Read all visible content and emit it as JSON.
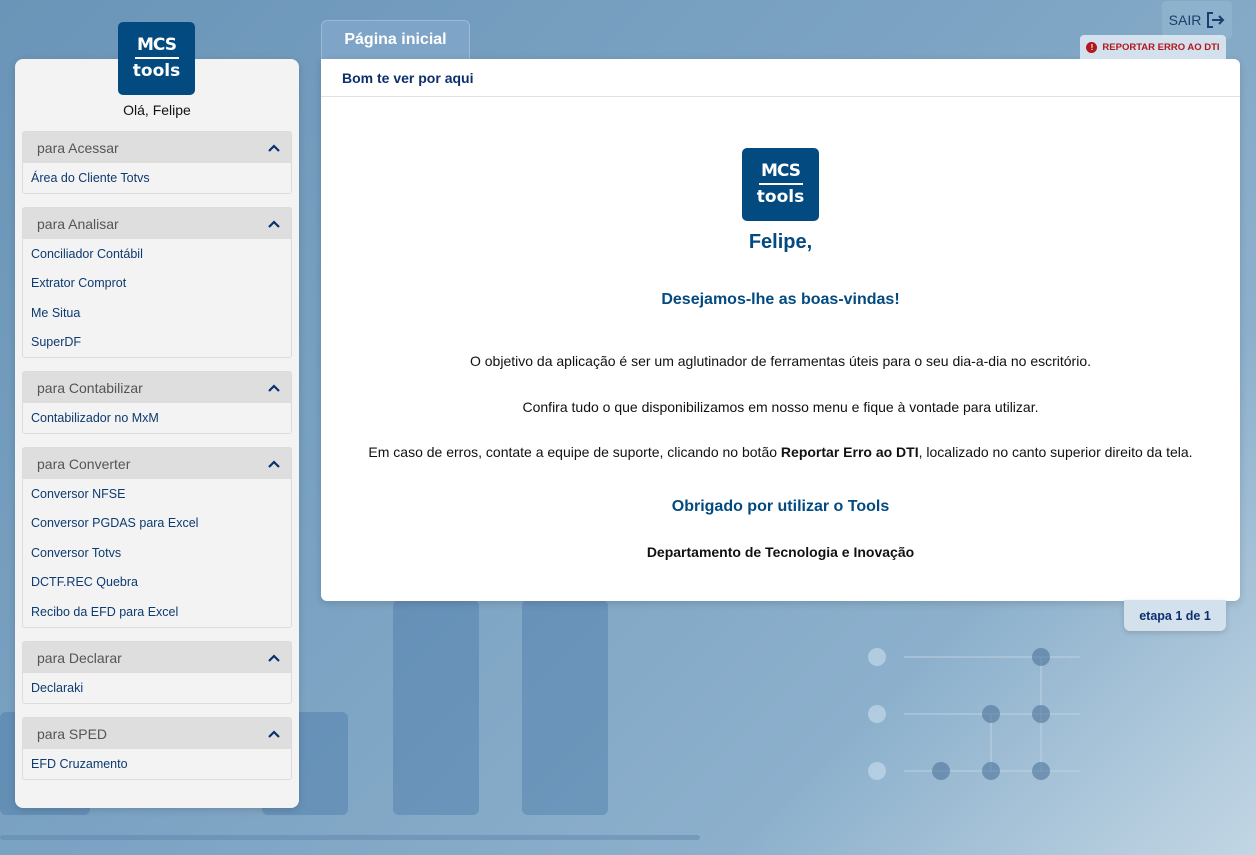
{
  "header": {
    "logout_label": "SAIR",
    "logout_icon": "logout-icon",
    "report_label": "REPORTAR ERRO AO DTI",
    "report_icon": "alert-circle-icon"
  },
  "logo": {
    "line1": "MCS",
    "line2": "tools"
  },
  "sidebar": {
    "greeting": "Olá, Felipe",
    "groups": [
      {
        "title": "para Acessar",
        "items": [
          "Área do Cliente Totvs"
        ]
      },
      {
        "title": "para Analisar",
        "items": [
          "Conciliador Contábil",
          "Extrator Comprot",
          "Me Situa",
          "SuperDF"
        ]
      },
      {
        "title": "para Contabilizar",
        "items": [
          "Contabilizador no MxM"
        ]
      },
      {
        "title": "para Converter",
        "items": [
          "Conversor NFSE",
          "Conversor PGDAS para Excel",
          "Conversor Totvs",
          "DCTF.REC Quebra",
          "Recibo da EFD para Excel"
        ]
      },
      {
        "title": "para Declarar",
        "items": [
          "Declaraki"
        ]
      },
      {
        "title": "para SPED",
        "items": [
          "EFD Cruzamento"
        ]
      }
    ]
  },
  "main": {
    "tab_label": "Página inicial",
    "panel_title": "Bom te ver por aqui",
    "user_name": "Felipe,",
    "welcome": "Desejamos-lhe as boas-vindas!",
    "paragraph1": "O objetivo da aplicação é ser um aglutinador de ferramentas úteis para o seu dia-a-dia no escritório.",
    "paragraph2": "Confira tudo o que disponibilizamos em nosso menu e fique à vontade para utilizar.",
    "paragraph3_before": "Em caso de erros, contate a equipe de suporte, clicando no botão ",
    "paragraph3_bold": "Reportar Erro ao DTI",
    "paragraph3_after": ", localizado no canto superior direito da tela.",
    "thanks": "Obrigado por utilizar o Tools",
    "department": "Departamento de Tecnologia e Inovação",
    "step_label": "etapa 1 de 1"
  },
  "colors": {
    "brand": "#034a80",
    "link": "#0d3a70",
    "alert": "#b3161d"
  }
}
